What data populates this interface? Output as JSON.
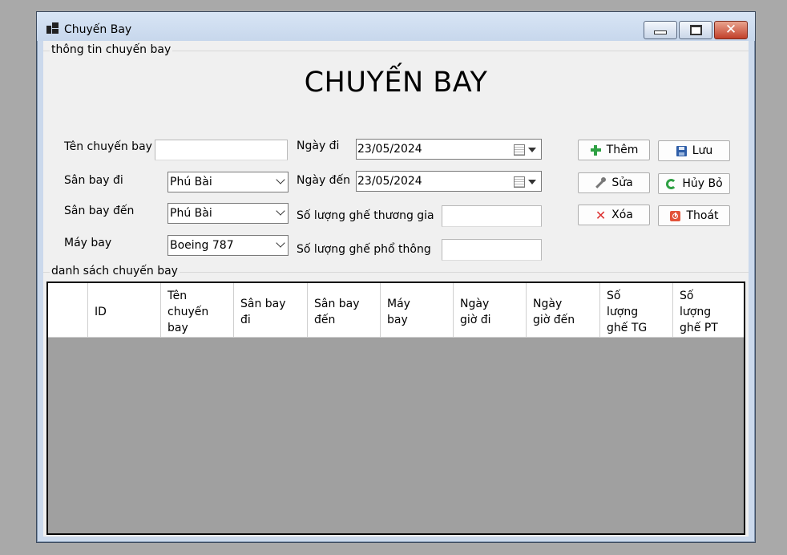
{
  "window": {
    "title": "Chuyến Bay",
    "minimize_icon": "minimize-icon",
    "maximize_icon": "maximize-icon",
    "close_icon": "close-icon"
  },
  "info_group": {
    "legend": "thông tin chuyến bay",
    "heading": "CHUYẾN BAY",
    "fields": {
      "flight_name_label": "Tên chuyến bay",
      "flight_name_value": "",
      "departure_airport_label": "Sân bay đi",
      "departure_airport_value": "Phú Bài",
      "arrival_airport_label": "Sân bay đến",
      "arrival_airport_value": "Phú Bài",
      "aircraft_label": "Máy bay",
      "aircraft_value": "Boeing 787",
      "departure_date_label": "Ngày đi",
      "departure_date_value": "23/05/2024",
      "arrival_date_label": "Ngày đến",
      "arrival_date_value": "23/05/2024",
      "business_seats_label": "Số lượng ghế thương gia",
      "business_seats_value": "",
      "economy_seats_label": "Số lượng ghế phổ thông",
      "economy_seats_value": ""
    },
    "buttons": {
      "add": "Thêm",
      "save": "Lưu",
      "edit": "Sửa",
      "cancel": "Hủy Bỏ",
      "delete": "Xóa",
      "exit": "Thoát"
    }
  },
  "list_group": {
    "legend": "danh sách chuyến bay",
    "columns": [
      "",
      "ID",
      "Tên\nchuyến\nbay",
      "Sân bay\nđi",
      "Sân bay\nđến",
      "Máy\nbay",
      "Ngày\ngiờ đi",
      "Ngày\ngiờ đến",
      "Số\nlượng\nghế TG",
      "Số\nlượng\nghế PT"
    ],
    "rows": []
  },
  "colors": {
    "title_bar": "#c7d7ec",
    "close_button": "#c2402a",
    "grid_background": "#a0a0a0",
    "form_background": "#f0f0f0"
  }
}
